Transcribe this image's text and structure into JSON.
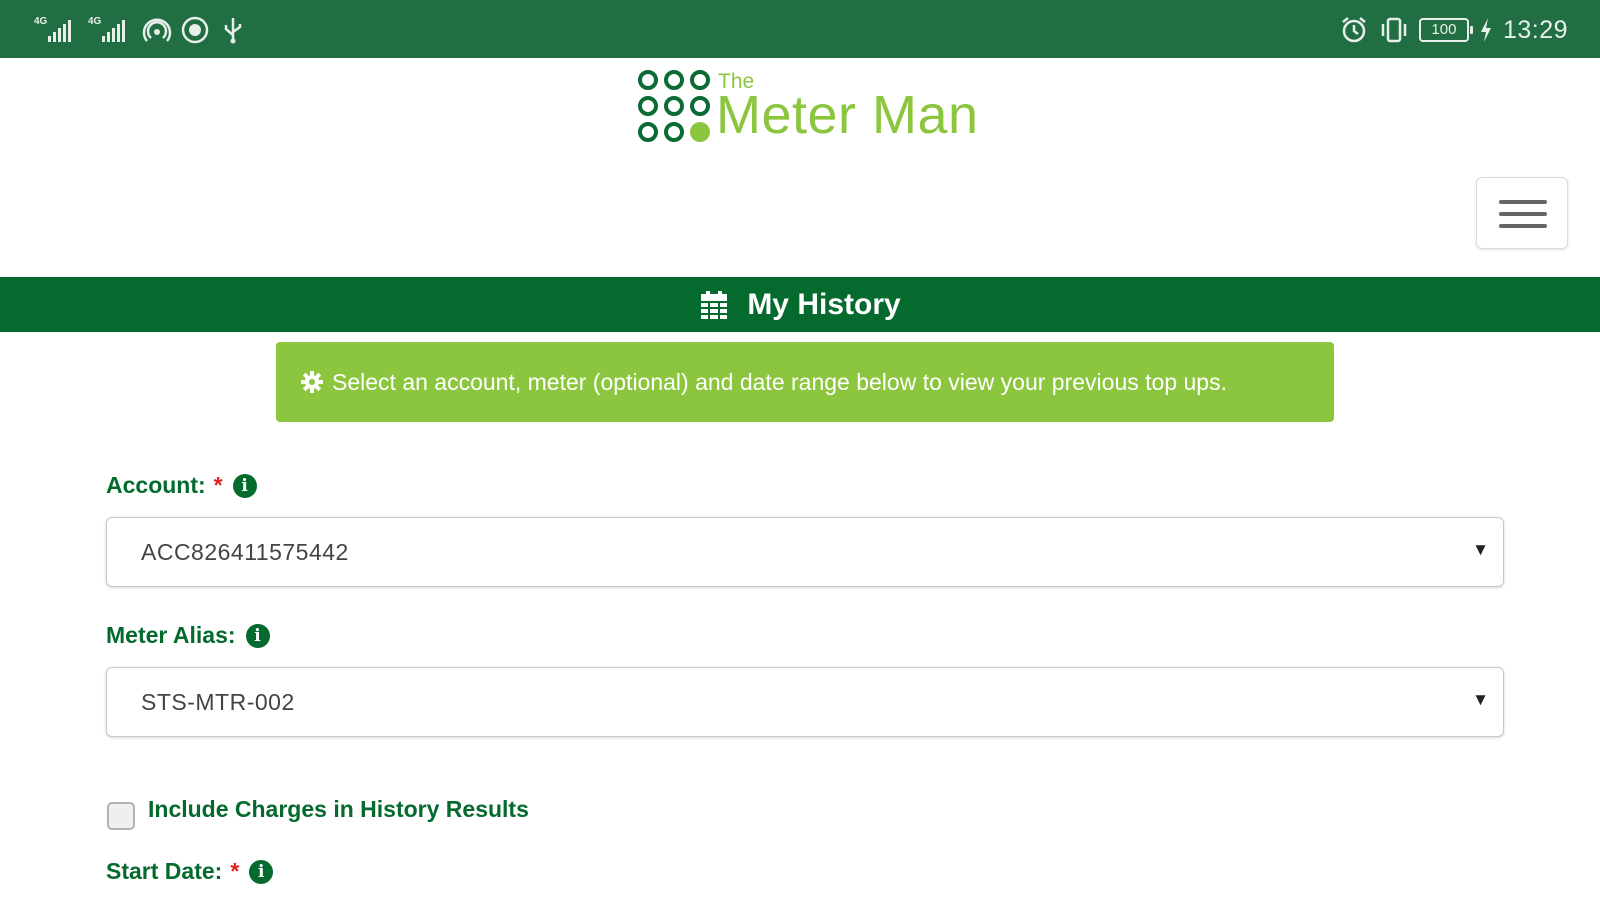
{
  "status_bar": {
    "network_1": "4G",
    "network_2": "4G",
    "icons": [
      "signal-icon",
      "signal-icon",
      "hotspot-icon",
      "settings-round-icon",
      "usb-icon",
      "alarm-icon",
      "vibrate-icon",
      "battery-icon",
      "charging-icon"
    ],
    "battery": "100",
    "time": "13:29"
  },
  "header": {
    "logo_small": "The",
    "logo_name": "Meter Man",
    "menu_icon": "hamburger-menu-icon"
  },
  "page": {
    "title": "My History",
    "title_icon": "calendar-icon"
  },
  "alert": {
    "icon": "gear-icon",
    "message": "Select an account, meter (optional) and date range below to view your previous top ups."
  },
  "form": {
    "account": {
      "label": "Account:",
      "required_mark": "*",
      "value": "ACC826411575442"
    },
    "meter_alias": {
      "label": "Meter Alias:",
      "value": "STS-MTR-002"
    },
    "include_charges": {
      "label": "Include Charges in History Results",
      "checked": false
    },
    "start_date": {
      "label": "Start Date:",
      "required_mark": "*"
    },
    "info_icon": "i",
    "caret": "▼"
  },
  "colors": {
    "status_bar": "#216e43",
    "brand_dark_green": "#046a2e",
    "brand_light_green": "#8cc63f",
    "required_red": "#e02020"
  }
}
